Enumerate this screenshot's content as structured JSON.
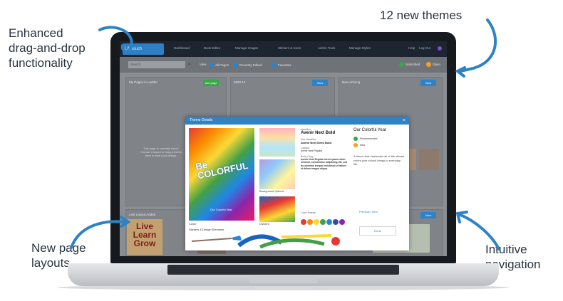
{
  "callouts": {
    "drag": [
      "Enhanced",
      "drag-and-drop",
      "functionality"
    ],
    "themes": "12 new themes",
    "layouts": [
      "New page",
      "layouts"
    ],
    "navigation": [
      "Intuitive",
      "navigation"
    ]
  },
  "app": {
    "logo": "Lifetouch",
    "nav": [
      "Dashboard",
      "Book Editor",
      "Manage Images",
      "Stickers & Icons",
      "Admin Tools",
      "Manage Styles",
      "Help",
      "Log Out"
    ],
    "search_placeholder": "Search",
    "filters": [
      "View",
      "All Pages",
      "Recently Edited",
      "Favorites"
    ],
    "legend": [
      "Submitted",
      "Open"
    ],
    "panels": [
      {
        "title": "My Pages in Ladder",
        "button": "Add page"
      },
      {
        "title": "2020 14",
        "button": "View"
      },
      {
        "title": "New Arriving",
        "button": "View"
      },
      {
        "title": "Last Layout Added",
        "button": "View"
      }
    ],
    "empty_text": "This page is currently blank. Choose a layout or drag a theme here to start your design.",
    "live_card": [
      "Live",
      "Learn",
      "Grow"
    ]
  },
  "modal": {
    "title": "Theme Details",
    "close": "×",
    "cover_title": "Be COLORFUL",
    "cover_sub": "Our Colorful Year",
    "cover_label": "Cover",
    "swatch_labels": [
      "Background Options",
      "Dividers"
    ],
    "typography": {
      "headline_label": "Headline",
      "headline_font": "Avenir Next Bold",
      "subheadline_label": "Sub Headline",
      "subheadline_font": "Avenir Next Demi Bold",
      "caption_label": "Caption",
      "caption_font": "Avenir Next Regular",
      "body_label": "Body Copy",
      "body_text": "Avenir Next Regular lorem ipsum dolor sit amet, consectetur adipiscing elit, sed do eiusmod tempor incididunt ut labore et dolore magna aliqua."
    },
    "palette_label": "Color Palette",
    "palette": [
      "#e53935",
      "#fb8c00",
      "#fdd835",
      "#43a047",
      "#1e88e5",
      "#3949ab",
      "#8e24aa"
    ],
    "right": {
      "title": "Our Colorful Year",
      "tags": [
        "Recommended",
        "New"
      ],
      "description": "A theme that celebrates all of the vibrant colors your school brings to everyday life.",
      "pager": "Previous | Next",
      "done": "Done"
    },
    "brushes_label": "Stickers & Design Elements"
  },
  "colors": {
    "accent": "#2d83c5",
    "green": "#3aa64a",
    "orange": "#f0a030"
  }
}
